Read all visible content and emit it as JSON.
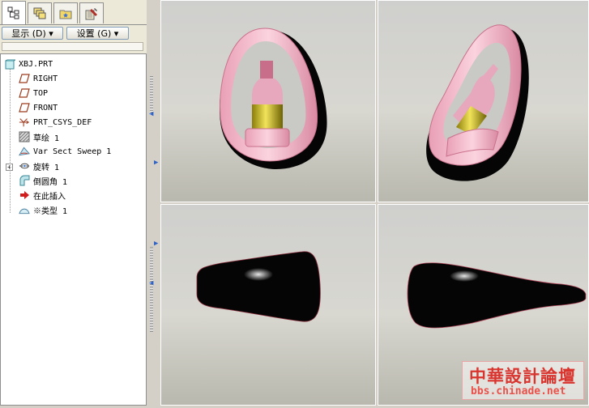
{
  "toolbar": {
    "show_label": "显示 (D) ▾",
    "settings_label": "设置 (G) ▾"
  },
  "tabs": [
    {
      "icon": "model-tree-icon"
    },
    {
      "icon": "layers-icon"
    },
    {
      "icon": "folder-star-icon"
    },
    {
      "icon": "tools-icon"
    }
  ],
  "tree": {
    "items": [
      {
        "label": "XBJ.PRT",
        "icon": "part-icon"
      },
      {
        "label": "RIGHT",
        "icon": "datum-plane-icon"
      },
      {
        "label": "TOP",
        "icon": "datum-plane-icon"
      },
      {
        "label": "FRONT",
        "icon": "datum-plane-icon"
      },
      {
        "label": "PRT_CSYS_DEF",
        "icon": "csys-icon"
      },
      {
        "label": "草绘 1",
        "icon": "sketch-icon"
      },
      {
        "label": "Var Sect Sweep 1",
        "icon": "sweep-icon"
      },
      {
        "label": "旋转 1",
        "icon": "revolve-icon"
      },
      {
        "label": "倒圆角 1",
        "icon": "round-icon"
      },
      {
        "label": "在此插入",
        "icon": "insert-here-icon"
      },
      {
        "label": "※类型 1",
        "icon": "surface-icon"
      }
    ]
  },
  "watermark": {
    "title": "中華設計論壇",
    "url": "bbs.chinade.net"
  },
  "colors": {
    "panel_bg": "#ece9d8",
    "viewport_bg": "#d8d7d0",
    "pink": "#f2a8bf",
    "bottle_gold": "#d9c21a",
    "body_black": "#050505"
  }
}
